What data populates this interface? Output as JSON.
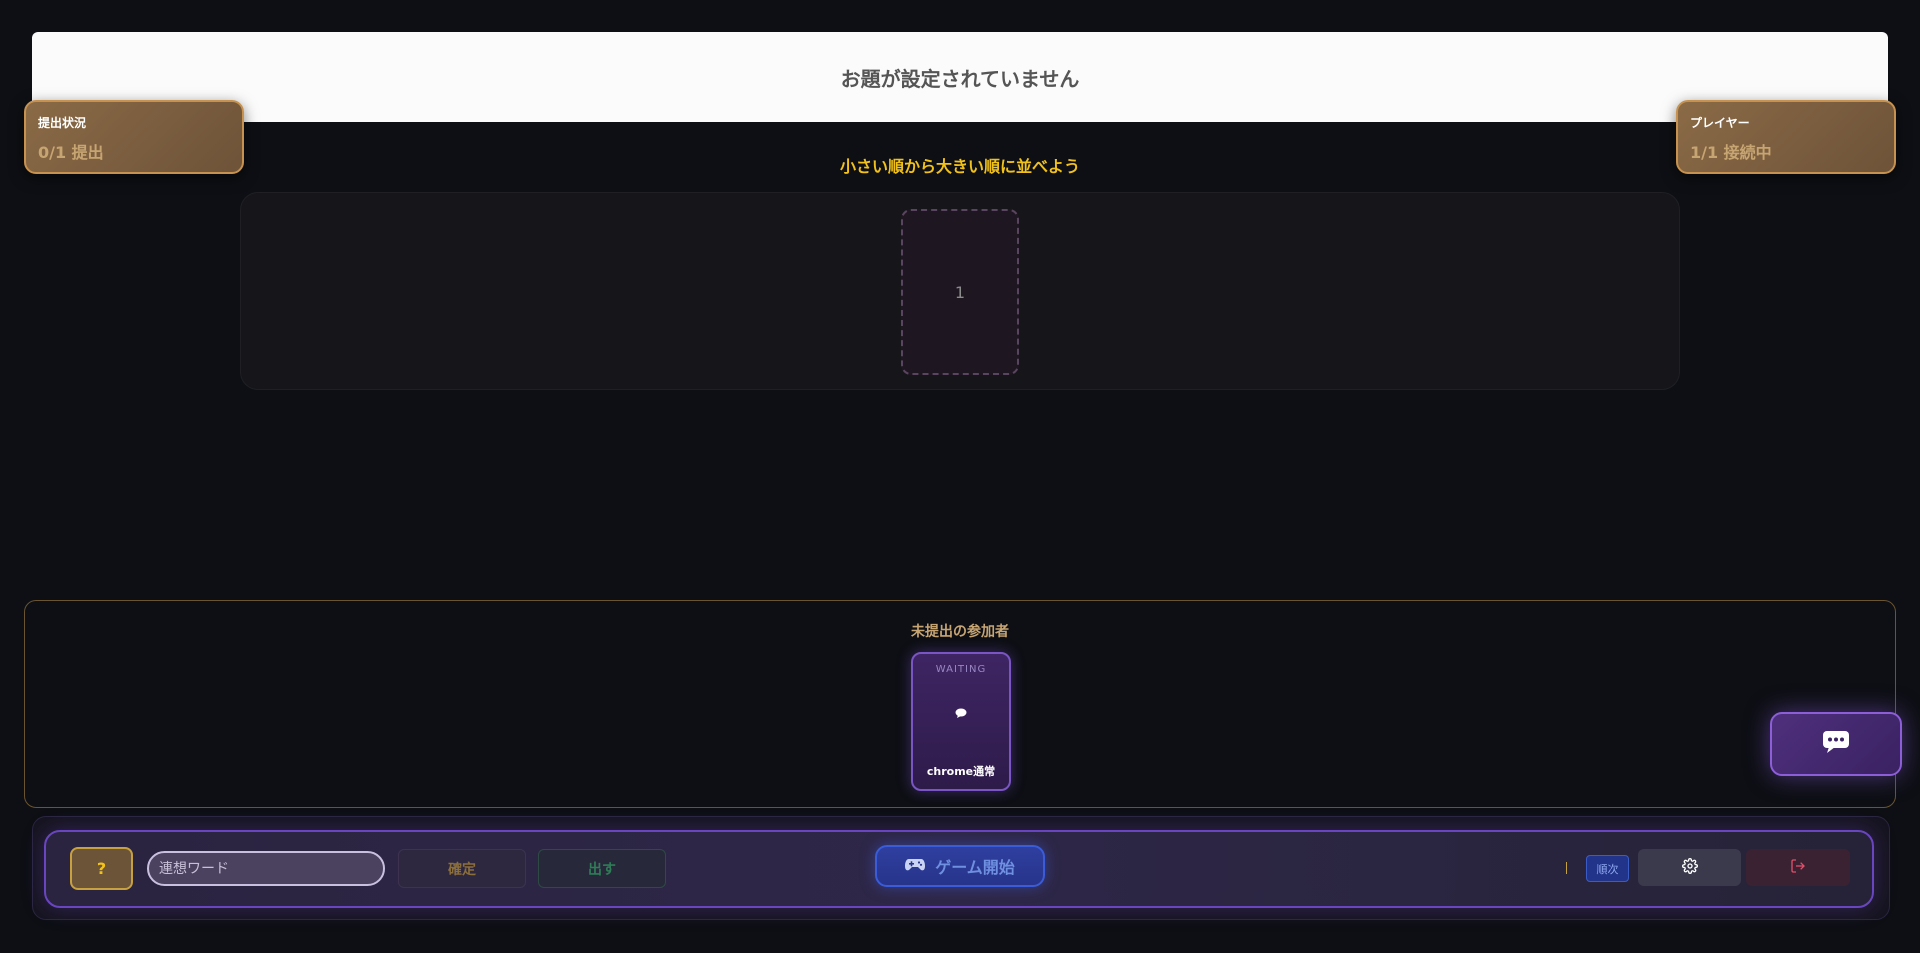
{
  "topic": {
    "text": "お題が設定されていません"
  },
  "submission_status": {
    "label": "提出状況",
    "value": "0/1 提出"
  },
  "players_status": {
    "label": "プレイヤー",
    "value": "1/1 接続中"
  },
  "instruction": "小さい順から大きい順に並べよう",
  "arrange_area": {
    "slots": [
      "1"
    ]
  },
  "pending": {
    "title": "未提出の参加者",
    "players": [
      {
        "status": "WAITING",
        "icon": "speech-bubble-icon",
        "name": "chrome通常"
      }
    ]
  },
  "chat": {
    "icon": "chat-icon"
  },
  "controls": {
    "help_label": "?",
    "word_placeholder": "連想ワード",
    "confirm_label": "確定",
    "submit_label": "出す",
    "start_label": "ゲーム開始",
    "start_icon": "gamepad-icon",
    "order_badge": "順次",
    "settings_icon": "gear-icon",
    "exit_icon": "logout-icon"
  },
  "colors": {
    "accent_gold": "#f2c21a",
    "accent_purple": "#6a45c0",
    "accent_blue": "#3b5cd9"
  }
}
